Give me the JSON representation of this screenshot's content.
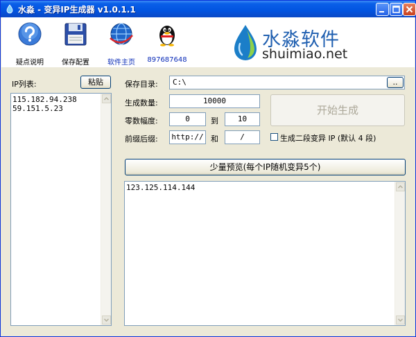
{
  "window": {
    "title": "水淼 - 变异IP生成器 v1.0.1.1"
  },
  "toolbar": {
    "items": [
      {
        "label": "疑点说明",
        "icon": "help-icon"
      },
      {
        "label": "保存配置",
        "icon": "floppy-disk-icon"
      },
      {
        "label": "软件主页",
        "icon": "globe-icon"
      },
      {
        "label": "897687648",
        "icon": "qq-penguin-icon"
      }
    ],
    "logo_cn": "水淼软件",
    "logo_en": "shuimiao.net"
  },
  "left": {
    "ip_list_label": "IP列表:",
    "paste_button": "粘贴",
    "ip_list": "115.182.94.238\n59.151.5.23"
  },
  "form": {
    "save_dir_label": "保存目录:",
    "save_dir_value": "C:\\",
    "browse_button": "..",
    "count_label": "生成数量:",
    "count_value": "10000",
    "range_label": "零数幅度:",
    "range_from": "0",
    "range_to_label": "到",
    "range_to": "10",
    "affix_label": "前缀后缀:",
    "prefix_value": "http://",
    "and_label": "和",
    "suffix_value": "/",
    "start_button": "开始生成",
    "second_segment_checkbox": "生成二段变异 IP (默认 4 段)",
    "second_segment_checked": false,
    "preview_button": "少量预览(每个IP随机变异5个)",
    "preview_output": "123.125.114.144"
  },
  "colors": {
    "titlebar": "#0254e0",
    "face": "#ece9d8",
    "disabled_text": "#aca899",
    "link_blue": "#0a2bb7"
  }
}
